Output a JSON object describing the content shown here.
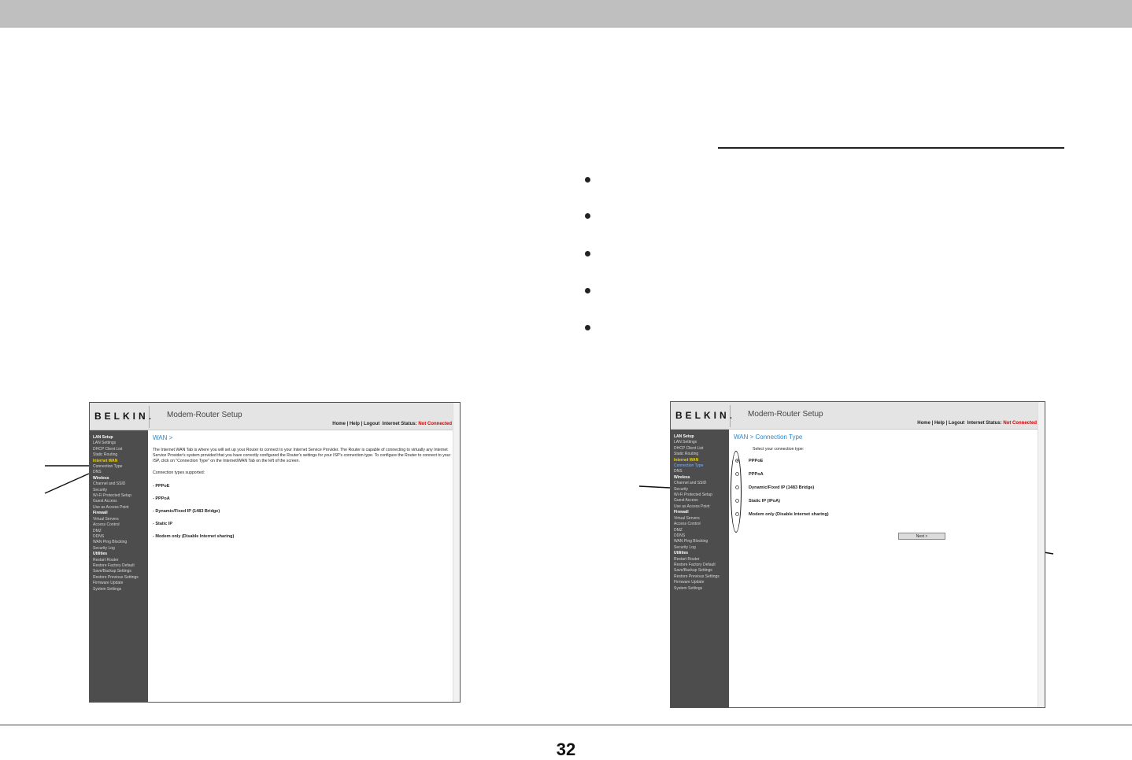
{
  "page_number": "32",
  "screenshot_left": {
    "logo": "BELKIN.",
    "app_title": "Modem-Router Setup",
    "links": {
      "home": "Home",
      "help": "Help",
      "logout": "Logout",
      "status_label": "Internet Status:",
      "status_value": "Not Connected"
    },
    "sidebar": [
      {
        "text": "LAN Setup",
        "style": "hdr"
      },
      {
        "text": "LAN Settings",
        "style": ""
      },
      {
        "text": "DHCP Client List",
        "style": ""
      },
      {
        "text": "Static Routing",
        "style": ""
      },
      {
        "text": "Internet WAN",
        "style": "act"
      },
      {
        "text": "Connection Type",
        "style": ""
      },
      {
        "text": "DNS",
        "style": ""
      },
      {
        "text": "Wireless",
        "style": "hdr"
      },
      {
        "text": "Channel and SSID",
        "style": ""
      },
      {
        "text": "Security",
        "style": ""
      },
      {
        "text": "Wi-Fi Protected Setup",
        "style": ""
      },
      {
        "text": "Guest Access",
        "style": ""
      },
      {
        "text": "Use as Access Point",
        "style": ""
      },
      {
        "text": "Firewall",
        "style": "hdr"
      },
      {
        "text": "Virtual Servers",
        "style": ""
      },
      {
        "text": "Access Control",
        "style": ""
      },
      {
        "text": "DMZ",
        "style": ""
      },
      {
        "text": "DDNS",
        "style": ""
      },
      {
        "text": "WAN Ping Blocking",
        "style": ""
      },
      {
        "text": "Security Log",
        "style": ""
      },
      {
        "text": "Utilities",
        "style": "hdr"
      },
      {
        "text": "Restart Router",
        "style": ""
      },
      {
        "text": "Restore Factory Default",
        "style": ""
      },
      {
        "text": "Save/Backup Settings",
        "style": ""
      },
      {
        "text": "Restore Previous Settings",
        "style": ""
      },
      {
        "text": "Firmware Update",
        "style": ""
      },
      {
        "text": "System Settings",
        "style": ""
      }
    ],
    "content_title": "WAN >",
    "paragraph": "The Internet WAN Tab is where you will set up your Router to connect to your Internet Service Provider. The Router is capable of connecting to virtually any Internet Service Provider's system provided that you have correctly configured the Router's settings for your ISP's connection type. To configure the Router to connect to your ISP, click on \"Connection Type\" on the Internet/WAN Tab on the left of the screen.",
    "supported_label": "Connection types supported:",
    "types": [
      "- PPPoE",
      "- PPPoA",
      "- Dynamic/Fixed IP (1483 Bridge)",
      "- Static IP",
      "- Modem only (Disable Internet sharing)"
    ]
  },
  "screenshot_right": {
    "logo": "BELKIN.",
    "app_title": "Modem-Router Setup",
    "links": {
      "home": "Home",
      "help": "Help",
      "logout": "Logout",
      "status_label": "Internet Status:",
      "status_value": "Not Connected"
    },
    "sidebar": [
      {
        "text": "LAN Setup",
        "style": "hdr"
      },
      {
        "text": "LAN Settings",
        "style": ""
      },
      {
        "text": "DHCP Client List",
        "style": ""
      },
      {
        "text": "Static Routing",
        "style": ""
      },
      {
        "text": "Internet WAN",
        "style": "act"
      },
      {
        "text": "Connection Type",
        "style": "sub-act"
      },
      {
        "text": "DNS",
        "style": ""
      },
      {
        "text": "Wireless",
        "style": "hdr"
      },
      {
        "text": "Channel and SSID",
        "style": ""
      },
      {
        "text": "Security",
        "style": ""
      },
      {
        "text": "Wi-Fi Protected Setup",
        "style": ""
      },
      {
        "text": "Guest Access",
        "style": ""
      },
      {
        "text": "Use as Access Point",
        "style": ""
      },
      {
        "text": "Firewall",
        "style": "hdr"
      },
      {
        "text": "Virtual Servers",
        "style": ""
      },
      {
        "text": "Access Control",
        "style": ""
      },
      {
        "text": "DMZ",
        "style": ""
      },
      {
        "text": "DDNS",
        "style": ""
      },
      {
        "text": "WAN Ping Blocking",
        "style": ""
      },
      {
        "text": "Security Log",
        "style": ""
      },
      {
        "text": "Utilities",
        "style": "hdr"
      },
      {
        "text": "Restart Router",
        "style": ""
      },
      {
        "text": "Restore Factory Default",
        "style": ""
      },
      {
        "text": "Save/Backup Settings",
        "style": ""
      },
      {
        "text": "Restore Previous Settings",
        "style": ""
      },
      {
        "text": "Firmware Update",
        "style": ""
      },
      {
        "text": "System Settings",
        "style": ""
      }
    ],
    "content_title": "WAN > Connection Type",
    "select_label": "Select your connection type:",
    "options": [
      {
        "label": "PPPoE",
        "checked": true
      },
      {
        "label": "PPPoA",
        "checked": false
      },
      {
        "label": "Dynamic/Fixed IP (1483 Bridge)",
        "checked": false
      },
      {
        "label": "Static IP (IPoA)",
        "checked": false
      },
      {
        "label": "Modem only (Disable Internet sharing)",
        "checked": false
      }
    ],
    "next_button": "Next >"
  }
}
